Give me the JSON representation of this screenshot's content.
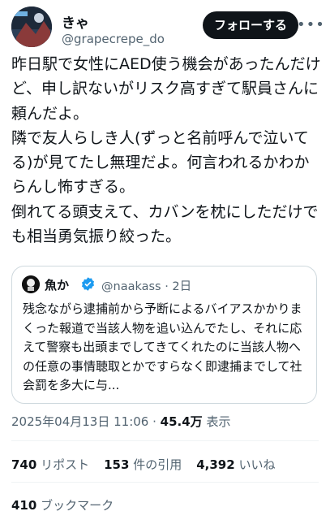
{
  "author": {
    "name": "きゃ",
    "handle": "@grapecrepe_do",
    "follow_label": "フォローする",
    "more_icon": "more-icon"
  },
  "tweet": {
    "text": "昨日駅で女性にAED使う機会があったんだけど、申し訳ないがリスク高すぎて駅員さんに頼んだよ。\n隣で友人らしき人(ずっと名前呼んで泣いてる)が見てたし無理だよ。何言われるかわからんし怖すぎる。\n倒れてる頭支えて、カバンを枕にしただけでも相当勇気振り絞った。"
  },
  "quote": {
    "name": "魚か",
    "handle": "@naakass · 2日",
    "text": "残念ながら逮捕前から予断によるバイアスかかりまくった報道で当該人物を追い込んでたし、それに応えて警察も出頭までしてきてくれたのに当該人物への任意の事情聴取とかですらなく即逮捕までして社会罰を多大に与..."
  },
  "meta": {
    "datetime": "2025年04月13日 11:06 · ",
    "views_count": "45.4万",
    "views_label": " 表示"
  },
  "stats": {
    "reposts_count": "740",
    "reposts_label": "リポスト",
    "quotes_count": "153",
    "quotes_label": "件の引用",
    "likes_count": "4,392",
    "likes_label": "いいね",
    "bookmarks_count": "410",
    "bookmarks_label": "ブックマーク"
  },
  "colors": {
    "text": "#0f1419",
    "secondary": "#536471",
    "verified": "#1d9bf0",
    "border": "#cfd9de"
  }
}
